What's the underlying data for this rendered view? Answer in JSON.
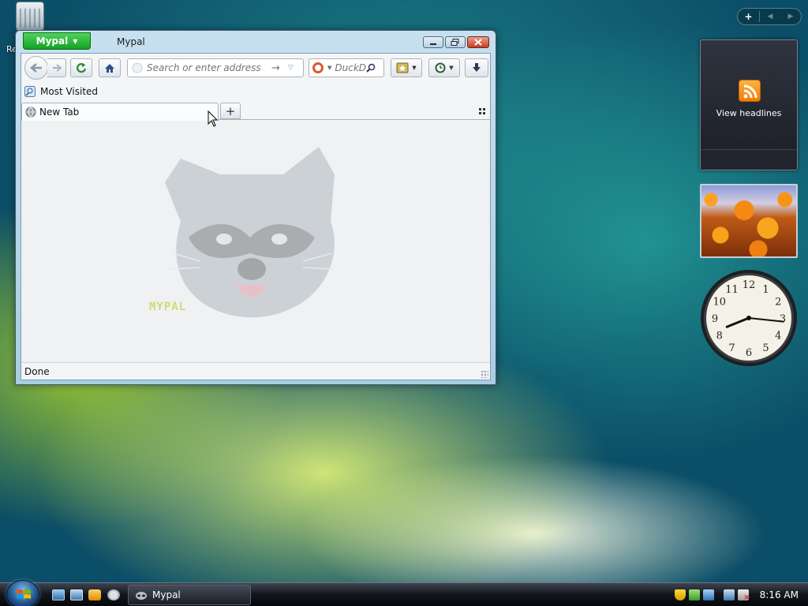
{
  "desktop": {
    "recycle_bin_label": "Re"
  },
  "window": {
    "title": "Mypal",
    "app_button_label": "Mypal",
    "nav": {
      "url_placeholder": "Search or enter address",
      "search_engine_placeholder": "DuckD"
    },
    "bookmarks": {
      "most_visited_label": "Most Visited"
    },
    "tabs": [
      {
        "label": "New Tab"
      }
    ],
    "content": {
      "watermark_text": "MYPAL"
    },
    "status_text": "Done"
  },
  "sidebar": {
    "feed_gadget_label": "View headlines",
    "clock": {
      "hour": 8,
      "minute": 16,
      "numerals": [
        "12",
        "1",
        "2",
        "3",
        "4",
        "5",
        "6",
        "7",
        "8",
        "9",
        "10",
        "11"
      ]
    }
  },
  "taskbar": {
    "task_label": "Mypal",
    "clock_text": "8:16 AM"
  },
  "colors": {
    "app_button": "#1fae33",
    "close_button": "#c23e25",
    "feed_orange": "#f07b06"
  }
}
